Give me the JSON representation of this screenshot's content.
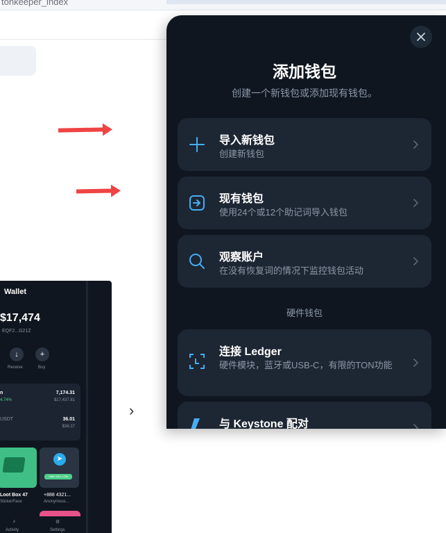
{
  "browser": {
    "tab_title": "tonkeeper_index"
  },
  "phone_preview": {
    "wallet_title": "Wallet",
    "balance": "$17,474",
    "address": "EQF2...G21Z",
    "receive_label": "Receive",
    "buy_label": "Buy",
    "row1_name": "n",
    "row1_change": "4.74%",
    "row1_amount": "7,174.31",
    "row1_fiat": "$17,437.81",
    "row2_name": "USDT",
    "row2_amount": "36.01",
    "row2_fiat": "$36.37",
    "nft1_name": "Loot Box 47",
    "nft1_collection": "StickerFace",
    "nft2_name": "+888 4321...",
    "nft2_collection": "Anonymous...",
    "nft2_badge": "+888 4321 1234",
    "nav_activity": "Activity",
    "nav_settings": "Settings"
  },
  "modal": {
    "title": "添加钱包",
    "subtitle": "创建一个新钱包或添加现有钱包。",
    "section_hardware": "硬件钱包",
    "options": [
      {
        "title": "导入新钱包",
        "desc": "创建新钱包",
        "icon": "plus-icon"
      },
      {
        "title": "现有钱包",
        "desc": "使用24个或12个助记词导入钱包",
        "icon": "import-icon"
      },
      {
        "title": "观察账户",
        "desc": "在没有恢复词的情况下监控钱包活动",
        "icon": "search-icon"
      },
      {
        "title": "连接 Ledger",
        "desc": "硬件模块，蓝牙或USB-C，有限的TON功能",
        "icon": "ledger-icon"
      },
      {
        "title": "与 Keystone 配对",
        "desc": "",
        "icon": "keystone-icon"
      }
    ]
  },
  "colors": {
    "modal_bg": "#0f1620",
    "card_bg": "#1d2633",
    "accent": "#45aef5",
    "muted_text": "#8c98a8",
    "arrow": "#ef4444"
  }
}
